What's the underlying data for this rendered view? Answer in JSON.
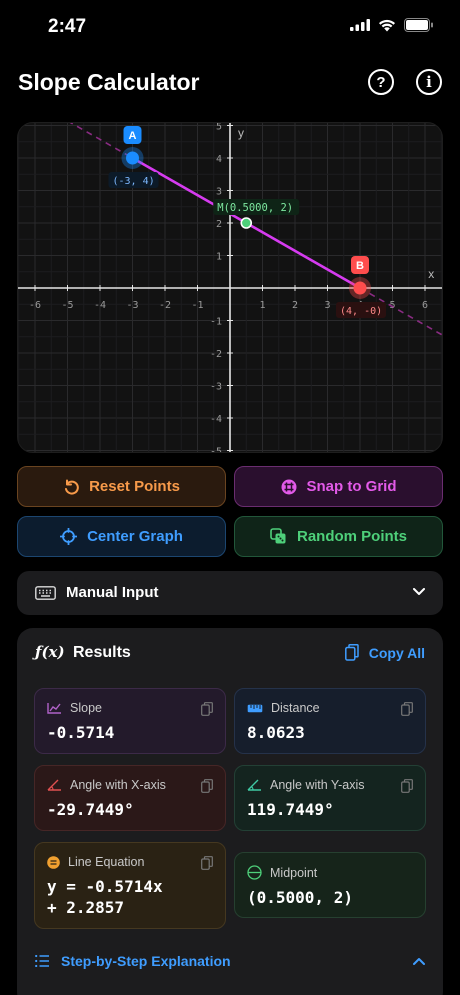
{
  "status": {
    "time": "2:47"
  },
  "header": {
    "title": "Slope Calculator",
    "help_icon": "question-circle-icon",
    "info_icon": "info-circle-icon"
  },
  "graph": {
    "x_axis_label": "x",
    "y_axis_label": "y",
    "x_ticks": [
      "-6",
      "-5",
      "-4",
      "-3",
      "-2",
      "-1",
      "1",
      "2",
      "3",
      "4",
      "5",
      "6"
    ],
    "y_ticks": [
      "5",
      "4",
      "3",
      "2",
      "1",
      "-1",
      "-2",
      "-3",
      "-4",
      "-5"
    ],
    "point_a": {
      "label": "A",
      "coord_text": "(-3, 4)",
      "color": "#1a8cff"
    },
    "point_b": {
      "label": "B",
      "coord_text": "(4, -0)",
      "color": "#ff4d4d"
    },
    "midpoint": {
      "label": "M(0.5000, 2)",
      "color": "#4ed07a"
    },
    "line_color": "#d63bf0"
  },
  "actions": {
    "reset": "Reset Points",
    "snap": "Snap to Grid",
    "center": "Center Graph",
    "random": "Random Points"
  },
  "manual_input": {
    "label": "Manual Input"
  },
  "results": {
    "title": "Results",
    "fx": "ƒ(x)",
    "copy_all": "Copy All",
    "slope": {
      "label": "Slope",
      "value": "-0.5714"
    },
    "distance": {
      "label": "Distance",
      "value": "8.0623"
    },
    "angle_x": {
      "label": "Angle with X-axis",
      "value": "-29.7449°"
    },
    "angle_y": {
      "label": "Angle with Y-axis",
      "value": "119.7449°"
    },
    "equation": {
      "label": "Line Equation",
      "value_line1": "y = -0.5714x",
      "value_line2": "+ 2.2857"
    },
    "midpoint": {
      "label": "Midpoint",
      "value": "(0.5000, 2)"
    },
    "steps": "Step-by-Step Explanation"
  }
}
